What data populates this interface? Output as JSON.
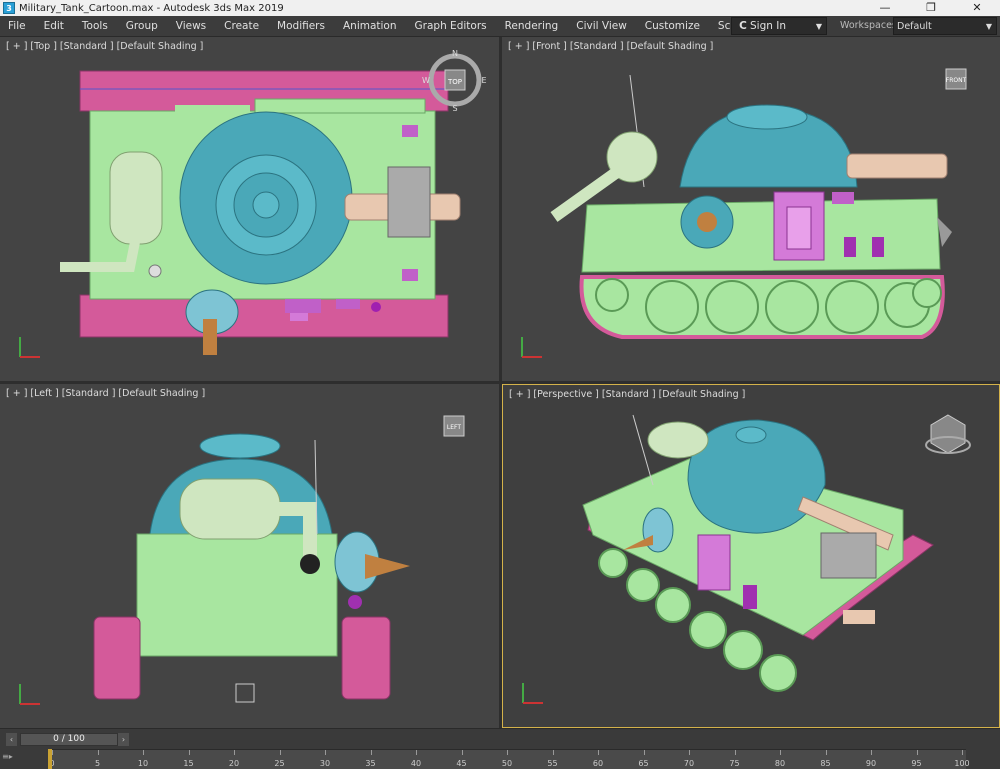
{
  "window": {
    "title": "Military_Tank_Cartoon.max - Autodesk 3ds Max 2019",
    "app_icon_letter": "3",
    "minimize": "—",
    "maximize": "❐",
    "close": "✕"
  },
  "menu": {
    "items": [
      "File",
      "Edit",
      "Tools",
      "Group",
      "Views",
      "Create",
      "Modifiers",
      "Animation",
      "Graph Editors",
      "Rendering",
      "Civil View",
      "Customize",
      "Scripting"
    ],
    "signin_icon": "C",
    "signin_label": "Sign In",
    "workspaces_label": "Workspaces:",
    "workspaces_value": "Default"
  },
  "viewports": {
    "top": {
      "label": "[ + ] [Top ] [Standard ] [Default Shading ]",
      "cube_label": "TOP",
      "compass": {
        "n": "N",
        "s": "S",
        "e": "E",
        "w": "W"
      }
    },
    "front": {
      "label": "[ + ] [Front ] [Standard ] [Default Shading ]",
      "cube_label": "FRONT"
    },
    "left": {
      "label": "[ + ] [Left ] [Standard ] [Default Shading ]",
      "cube_label": "LEFT"
    },
    "perspective": {
      "label": "[ + ] [Perspective ] [Standard ] [Default Shading ]"
    }
  },
  "timeline": {
    "frame_display": "0 / 100",
    "prev_arrow": "‹",
    "next_arrow": "›",
    "ticks": [
      "0",
      "5",
      "10",
      "15",
      "20",
      "25",
      "30",
      "35",
      "40",
      "45",
      "50",
      "55",
      "60",
      "65",
      "70",
      "75",
      "80",
      "85",
      "90",
      "95",
      "100"
    ],
    "corner_text": "≡▸"
  },
  "colors": {
    "body_green": "#a8e6a0",
    "turret_blue": "#4aa8b8",
    "track_pink": "#d45a9a",
    "barrel_tan": "#e8c8b0",
    "accent_purple": "#b050c0",
    "active_border": "#d4b24a"
  }
}
